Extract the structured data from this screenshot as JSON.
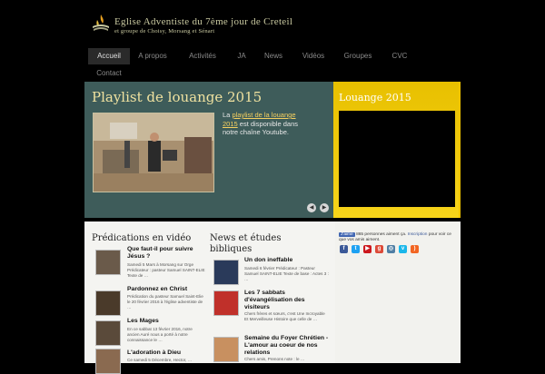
{
  "header": {
    "logo_line1": "Eglise Adventiste du 7ème jour de Creteil",
    "logo_line2": "et groupe de Choisy, Morsang et Sénart"
  },
  "nav": [
    {
      "label": "Accueil",
      "active": true
    },
    {
      "label": "A propos",
      "active": false
    },
    {
      "label": "Activités",
      "active": false
    },
    {
      "label": "JA",
      "active": false
    },
    {
      "label": "News",
      "active": false
    },
    {
      "label": "Vidéos",
      "active": false
    },
    {
      "label": "Groupes",
      "active": false
    },
    {
      "label": "CVC",
      "active": false
    },
    {
      "label": "Contact",
      "active": false
    }
  ],
  "slide": {
    "title": "Playlist de louange 2015",
    "text_before": "La",
    "link": "playlist de la louange 2015",
    "text_after": "est disponible dans notre chaîne Youtube.",
    "prev_icon": "◀",
    "next_icon": "▶"
  },
  "side": {
    "title": "Louange 2015"
  },
  "predications": {
    "title": "Prédications en vidéo",
    "items": [
      {
        "title": "Que faut-il pour suivre Jésus ?",
        "desc": "Samedi 5 Mars à Morsang sur Orge Prédicateur : pasteur Samuel SAINT-ELIE Texte de …"
      },
      {
        "title": "Pardonnez en Christ",
        "desc": "Prédication du pasteur Samuel Saint-Elie le 20 février 2016 à l'église adventiste de …"
      },
      {
        "title": "Les Mages",
        "desc": "En ce sabbat 13 février 2016, notre ancien Auré nous a porté à notre connaissance le …"
      },
      {
        "title": "L'adoration à Dieu",
        "desc": "Ce samedi 5 Décembre, Hector, …"
      }
    ]
  },
  "news": {
    "title": "News et études bibliques",
    "items": [
      {
        "title": "Un don ineffable",
        "desc": "Samedi 6 février Prédicateur : Pasteur Samuel SAINT-ELIE Texte de base : Actes 3 : …"
      },
      {
        "title": "Les 7 sabbats d'évangélisation des visiteurs",
        "desc": "Chers frères et sœurs, c'est Une Incroyable Et Merveilleuse Histoire que celle de …"
      },
      {
        "title": "Semaine du Foyer Chrétien - L'amour au coeur de nos relations",
        "desc": "Chers amis, Prenons note : le …"
      }
    ]
  },
  "sidebar": {
    "fb_badge": "J'aime",
    "fb_text": "865 personnes aiment ça.",
    "fb_link": "Inscription",
    "fb_after": "pour voir ce que vos amis aiment.",
    "social": [
      {
        "icon": "facebook-icon",
        "glyph": "f",
        "color": "#3b5998"
      },
      {
        "icon": "twitter-icon",
        "glyph": "t",
        "color": "#1da1f2"
      },
      {
        "icon": "youtube-icon",
        "glyph": "▶",
        "color": "#cc181e"
      },
      {
        "icon": "googleplus-icon",
        "glyph": "g",
        "color": "#dd4b39"
      },
      {
        "icon": "instagram-icon",
        "glyph": "◎",
        "color": "#517fa4"
      },
      {
        "icon": "vimeo-icon",
        "glyph": "v",
        "color": "#1ab7ea"
      },
      {
        "icon": "rss-icon",
        "glyph": ")",
        "color": "#f26522"
      }
    ]
  }
}
